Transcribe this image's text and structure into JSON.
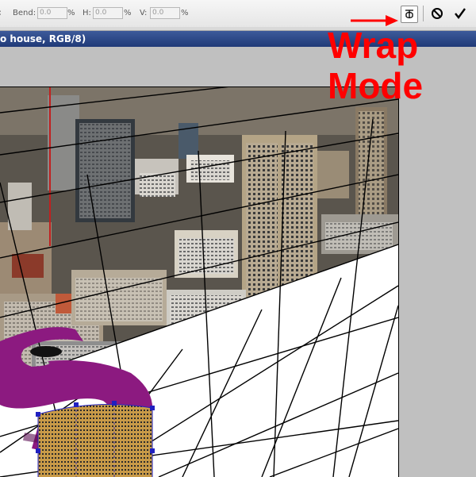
{
  "toolbar": {
    "bend_label": "Bend:",
    "bend_value": "0.0",
    "bend_unit": "%",
    "h_label": "H:",
    "h_value": "0.0",
    "h_unit": "%",
    "v_label": "V:",
    "v_value": "0.0",
    "v_unit": "%",
    "warp_mode_icon": "warp-mode-icon",
    "cancel_icon": "cancel-icon",
    "commit_icon": "checkmark-icon"
  },
  "document": {
    "title": "o house, RGB/8)"
  },
  "annotation": {
    "line1": "Wrap",
    "line2": "Mode",
    "color": "#ff0000"
  },
  "colors": {
    "purple_shape": "#8c1a80",
    "title_bar": "#2a4585",
    "warp_handles": "#2020c0"
  }
}
